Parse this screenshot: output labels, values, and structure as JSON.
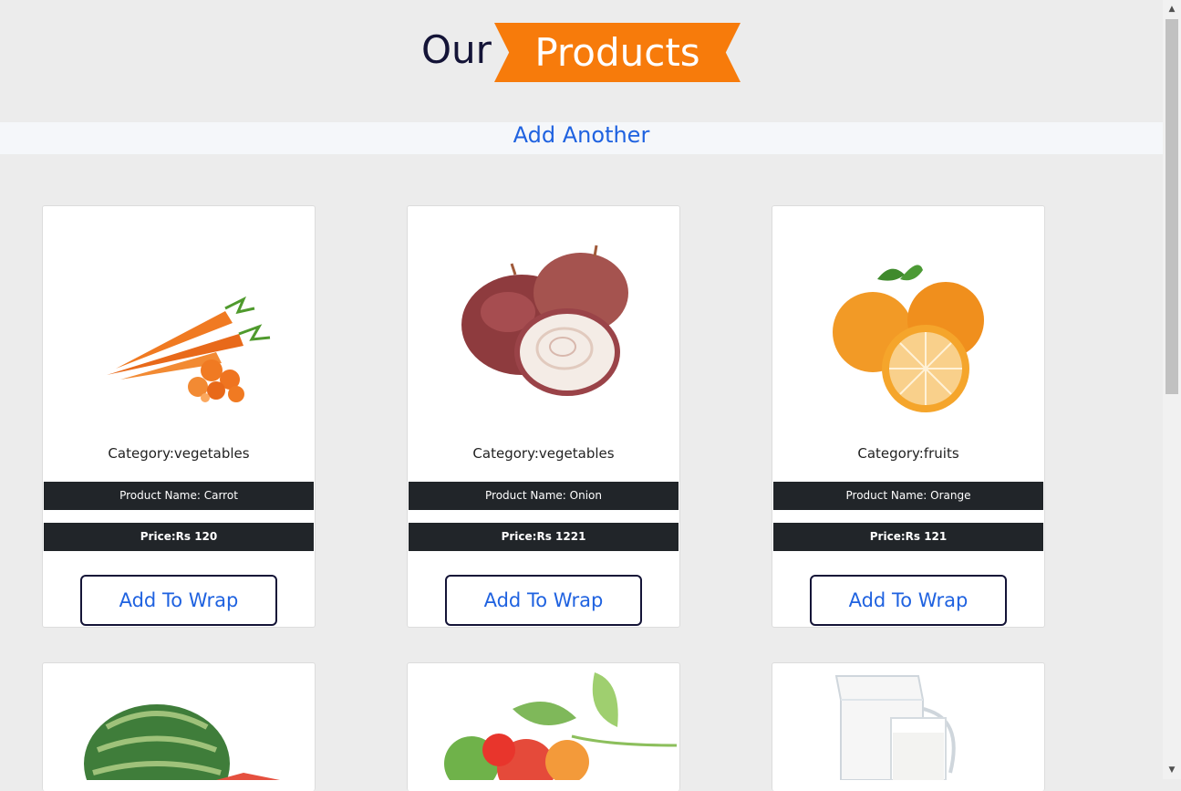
{
  "header": {
    "title_part1": "Our",
    "title_part2": "Products",
    "ribbon_color": "#f77b0b"
  },
  "actions": {
    "add_another_label": "Add Another"
  },
  "products": [
    {
      "category": "Category:vegetables",
      "name": "Product Name: Carrot",
      "price": "Price:Rs 120",
      "button_label": "Add To Wrap",
      "image": "carrot"
    },
    {
      "category": "Category:vegetables",
      "name": "Product Name: Onion",
      "price": "Price:Rs 1221",
      "button_label": "Add To Wrap",
      "image": "onion"
    },
    {
      "category": "Category:fruits",
      "name": "Product Name: Orange",
      "price": "Price:Rs 121",
      "button_label": "Add To Wrap",
      "image": "orange"
    }
  ],
  "more_products": [
    {
      "image": "watermelon"
    },
    {
      "image": "mixed-fruits"
    },
    {
      "image": "milk-jug"
    }
  ],
  "colors": {
    "accent_link": "#1f62e0",
    "dark_band": "#212529",
    "title_dark": "#141437"
  }
}
